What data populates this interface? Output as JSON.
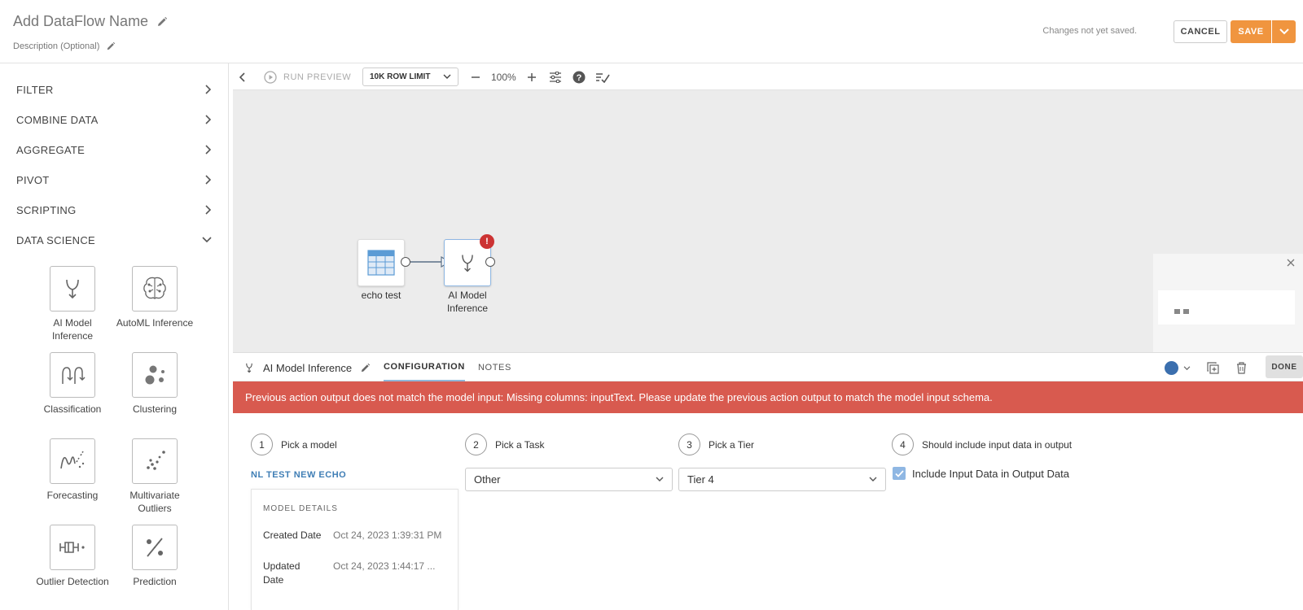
{
  "header": {
    "dataflow_name": "Add DataFlow Name",
    "description": "Description (Optional)",
    "status": "Changes not yet saved.",
    "cancel_label": "CANCEL",
    "save_label": "SAVE"
  },
  "sidebar": {
    "categories": [
      {
        "label": "FILTER"
      },
      {
        "label": "COMBINE DATA"
      },
      {
        "label": "AGGREGATE"
      },
      {
        "label": "PIVOT"
      },
      {
        "label": "SCRIPTING"
      },
      {
        "label": "DATA SCIENCE"
      }
    ],
    "tiles": [
      {
        "label": "AI Model Inference",
        "icon": "model-fork-icon"
      },
      {
        "label": "AutoML Inference",
        "icon": "brain-icon"
      },
      {
        "label": "Classification",
        "icon": "classification-icon"
      },
      {
        "label": "Clustering",
        "icon": "clustering-icon"
      },
      {
        "label": "Forecasting",
        "icon": "forecasting-icon"
      },
      {
        "label": "Multivariate Outliers",
        "icon": "scatter-icon"
      },
      {
        "label": "Outlier Detection",
        "icon": "outlier-icon"
      },
      {
        "label": "Prediction",
        "icon": "percent-icon"
      }
    ]
  },
  "toolbar": {
    "run_preview": "RUN PREVIEW",
    "row_limit": "10K ROW LIMIT",
    "zoom": "100%"
  },
  "canvas": {
    "nodes": [
      {
        "label": "echo test"
      },
      {
        "label": "AI Model Inference"
      }
    ]
  },
  "panel": {
    "action_name": "AI Model Inference",
    "tabs": [
      "CONFIGURATION",
      "NOTES"
    ],
    "done_label": "DONE",
    "color_accent": "#3b6fae",
    "error": "Previous action output does not match the model input: Missing columns: inputText. Please update the previous action output to match the model input schema.",
    "steps": [
      {
        "num": "1",
        "label": "Pick a model"
      },
      {
        "num": "2",
        "label": "Pick a Task"
      },
      {
        "num": "3",
        "label": "Pick a Tier"
      },
      {
        "num": "4",
        "label": "Should include input data in output"
      }
    ],
    "model_name": "NL TEST NEW ECHO",
    "task_value": "Other",
    "tier_value": "Tier 4",
    "include_label": "Include Input Data in Output Data",
    "include_checked": true,
    "model_details": {
      "title": "MODEL DETAILS",
      "created_label": "Created Date",
      "created_value": "Oct 24, 2023 1:39:31 PM",
      "updated_label": "Updated Date",
      "updated_value": "Oct 24, 2023 1:44:17 ..."
    }
  },
  "colors": {
    "accent_orange": "#f0953f",
    "error_red": "#d85a4f",
    "link_blue": "#3f7eb5"
  }
}
